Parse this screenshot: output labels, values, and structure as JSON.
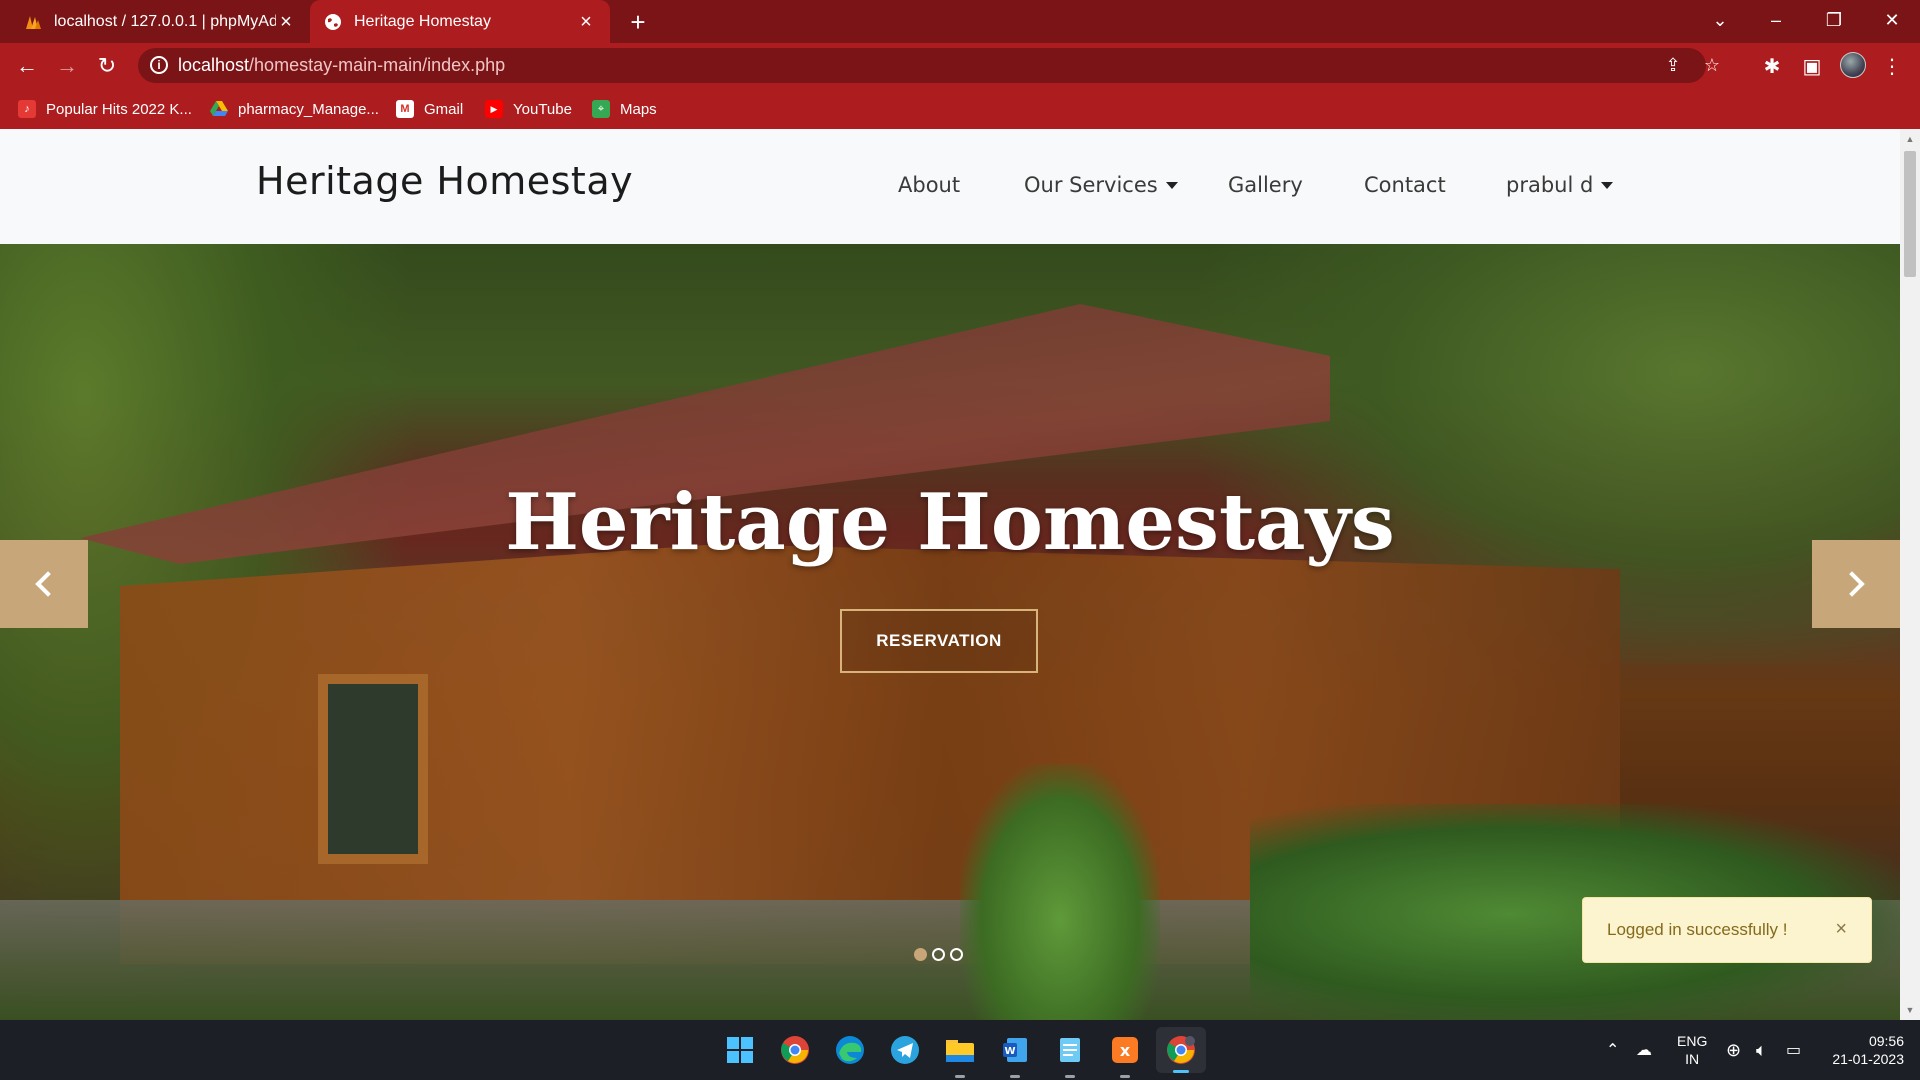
{
  "browser": {
    "tabs": [
      {
        "title": "localhost / 127.0.0.1 | phpMyAdmin",
        "icon": "phpmyadmin-icon"
      },
      {
        "title": "Heritage Homestay",
        "icon": "globe-icon"
      }
    ],
    "url_host": "localhost",
    "url_path": "/homestay-main-main/index.php",
    "bookmarks": [
      {
        "label": "Popular Hits 2022 K...",
        "icon": "music-icon",
        "color": "#e53935"
      },
      {
        "label": "pharmacy_Manage...",
        "icon": "drive-icon",
        "color": "#1e88e5"
      },
      {
        "label": "Gmail",
        "icon": "gmail-icon",
        "color": "#ffffff"
      },
      {
        "label": "YouTube",
        "icon": "youtube-icon",
        "color": "#ff0000"
      },
      {
        "label": "Maps",
        "icon": "maps-icon",
        "color": "#34a853"
      }
    ],
    "theme_colors": {
      "tabstrip": "#7b1416",
      "toolbar": "#ad1c1e"
    }
  },
  "site": {
    "brand": "Heritage Homestay",
    "nav": {
      "about": "About",
      "services": "Our Services",
      "gallery": "Gallery",
      "contact": "Contact",
      "user": "prabul d"
    },
    "hero": {
      "title": "Heritage Homestays",
      "button": "RESERVATION",
      "slides": 3,
      "active_slide": 1
    },
    "toast": {
      "message": "Logged in successfully !",
      "close": "×"
    },
    "accent_color": "#c7a77a"
  },
  "taskbar": {
    "apps": [
      "windows-start-icon",
      "chrome-icon",
      "edge-icon",
      "telegram-icon",
      "file-explorer-icon",
      "word-icon",
      "notepad-icon",
      "xampp-icon",
      "chrome-dev-icon"
    ],
    "lang_top": "ENG",
    "lang_bottom": "IN",
    "time": "09:56",
    "date": "21-01-2023"
  }
}
